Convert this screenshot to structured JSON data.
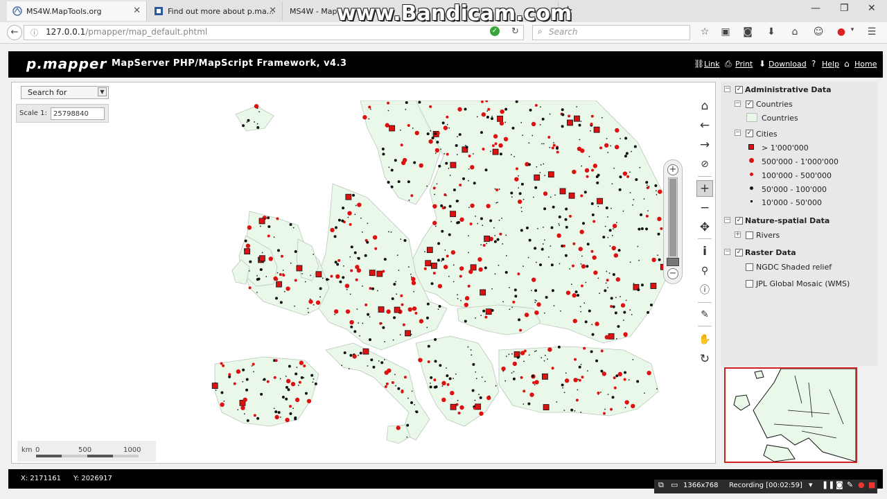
{
  "overlay": {
    "watermark": "www.Bandicam.com"
  },
  "browser": {
    "tabs": [
      {
        "title": "MS4W.MapTools.org"
      },
      {
        "title": "Find out more about p.ma..."
      },
      {
        "title": "MS4W - Map..."
      }
    ],
    "url_host": "127.0.0.1",
    "url_path": "/pmapper/map_default.phtml",
    "search_placeholder": "Search"
  },
  "app": {
    "logo": "p.mapper",
    "title": "MapServer PHP/MapScript Framework, v4.3",
    "header_links": [
      "Link",
      "Print",
      "Download",
      "Help",
      "Home"
    ]
  },
  "map": {
    "search_select": "Search for",
    "scale_label": "Scale 1:",
    "scale_value": "25798840",
    "scalebar": {
      "unit": "km",
      "ticks": [
        "0",
        "500",
        "1000"
      ]
    },
    "land_color": "#eaf8ea",
    "coord_x": "X: 2171161",
    "coord_y": "Y: 2026917"
  },
  "toolbar": [
    {
      "name": "home-icon"
    },
    {
      "name": "back-icon"
    },
    {
      "name": "forward-icon"
    },
    {
      "name": "zoom-select-icon"
    },
    {
      "name": "zoom-in-icon",
      "selected": true
    },
    {
      "name": "zoom-out-icon"
    },
    {
      "name": "pan-icon"
    },
    {
      "name": "identify-icon"
    },
    {
      "name": "select-icon"
    },
    {
      "name": "auto-identify-icon"
    },
    {
      "name": "measure-icon"
    },
    {
      "name": "clear-icon"
    },
    {
      "name": "refresh-icon"
    }
  ],
  "toc": {
    "groups": [
      {
        "label": "Administrative Data",
        "checked": true,
        "layers": [
          {
            "label": "Countries",
            "checked": true,
            "classes": [
              {
                "label": "Countries"
              }
            ]
          },
          {
            "label": "Cities",
            "checked": true,
            "classes": [
              {
                "label": "> 1'000'000"
              },
              {
                "label": "500'000 - 1'000'000"
              },
              {
                "label": "100'000 - 500'000"
              },
              {
                "label": "50'000 - 100'000"
              },
              {
                "label": "10'000 - 50'000"
              }
            ]
          }
        ]
      },
      {
        "label": "Nature-spatial Data",
        "checked": true,
        "layers": [
          {
            "label": "Rivers",
            "checked": false
          }
        ]
      },
      {
        "label": "Raster Data",
        "checked": true,
        "layers": [
          {
            "label": "NGDC Shaded relief",
            "checked": false
          },
          {
            "label": "JPL Global Mosaic (WMS)",
            "checked": false
          }
        ]
      }
    ],
    "legend_colors": {
      "red": "#dd1111",
      "black": "#111111"
    }
  },
  "recorder": {
    "resolution": "1366x768",
    "status": "Recording [00:02:59]"
  }
}
